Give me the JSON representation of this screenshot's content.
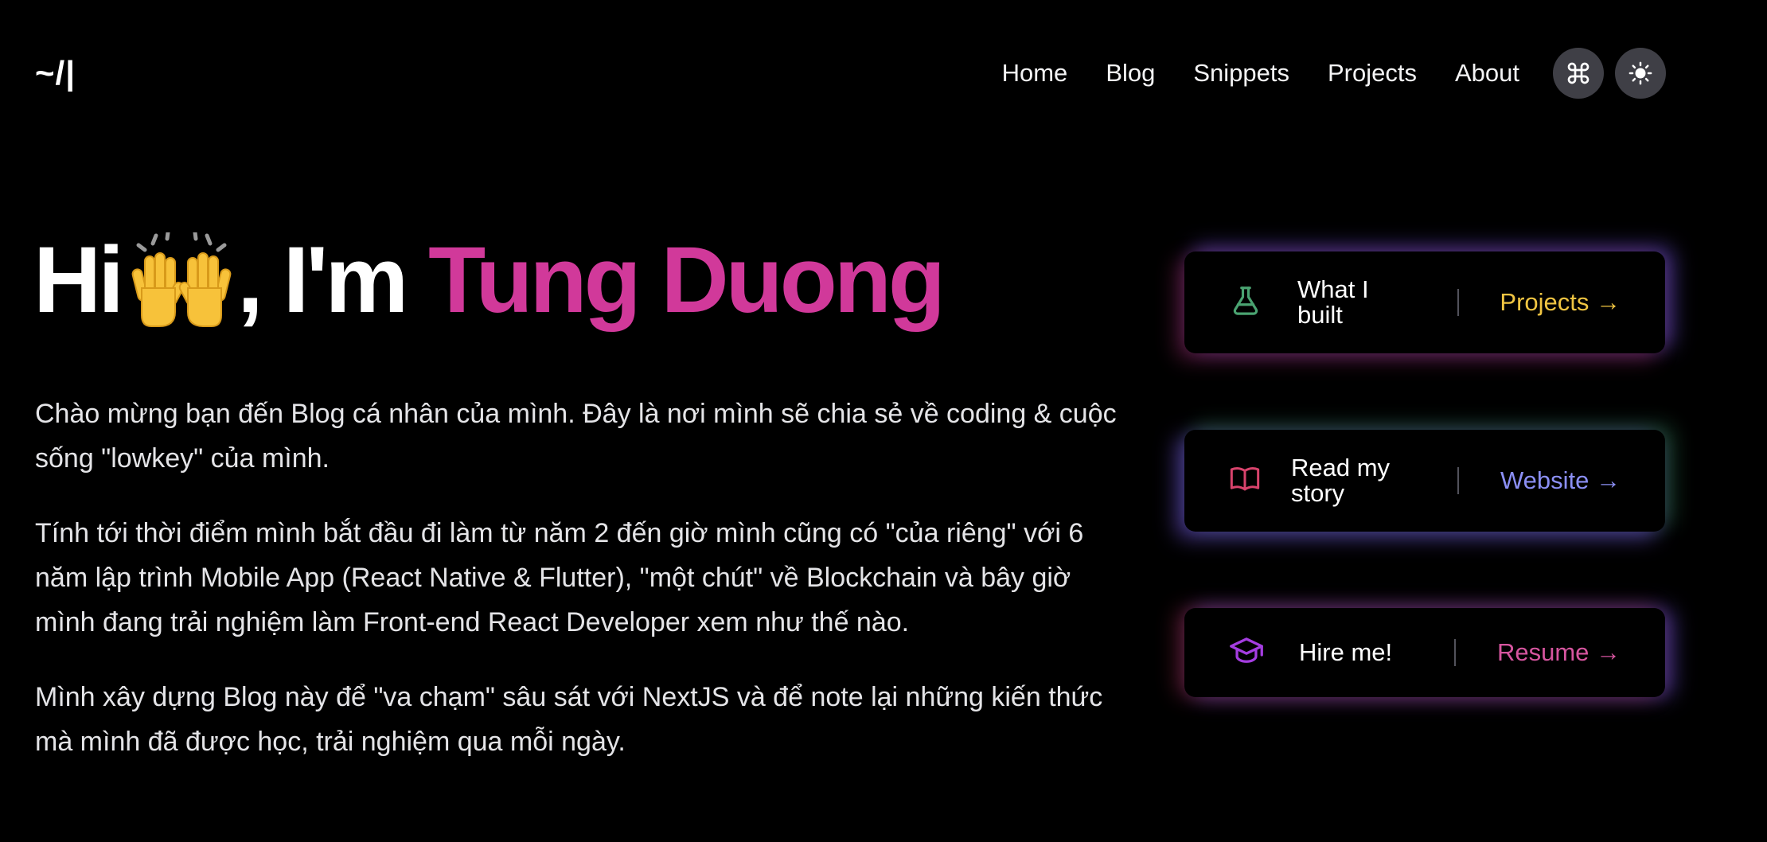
{
  "header": {
    "logo": "~/|",
    "nav": [
      "Home",
      "Blog",
      "Snippets",
      "Projects",
      "About"
    ]
  },
  "hero": {
    "greeting": "Hi",
    "emoji": "🙌",
    "intro": ", I'm ",
    "name": "Tung Duong"
  },
  "paragraphs": [
    "Chào mừng bạn đến Blog cá nhân của mình. Đây là nơi mình sẽ chia sẻ về coding & cuộc sống \"lowkey\" của mình.",
    "Tính tới thời điểm mình bắt đầu đi làm từ năm 2 đến giờ mình cũng có \"của riêng\" với 6 năm lập trình Mobile App (React Native & Flutter), \"một chút\" về Blockchain và bây giờ mình đang trải nghiệm làm Front-end React Developer xem như thế nào.",
    "Mình xây dựng Blog này để \"va chạm\" sâu sát với NextJS và để note lại những kiến thức mà mình đã được học, trải nghiệm qua mỗi ngày."
  ],
  "cards": [
    {
      "icon": "flask-icon",
      "label": "What I built",
      "link": "Projects →",
      "link_color": "#f0c542",
      "icon_color": "#4aa371"
    },
    {
      "icon": "book-icon",
      "label": "Read my story",
      "link": "Website →",
      "link_color": "#8b8ff5",
      "icon_color": "#d8436c"
    },
    {
      "icon": "graduation-cap-icon",
      "label": "Hire me!",
      "link": "Resume →",
      "link_color": "#d6559f",
      "icon_color": "#a43de0"
    }
  ],
  "colors": {
    "background": "#000000",
    "name_accent": "#d1399a",
    "icon_button_bg": "#3f3f46"
  },
  "icons": {
    "command_button": "command-icon",
    "theme_button": "sun-icon"
  }
}
